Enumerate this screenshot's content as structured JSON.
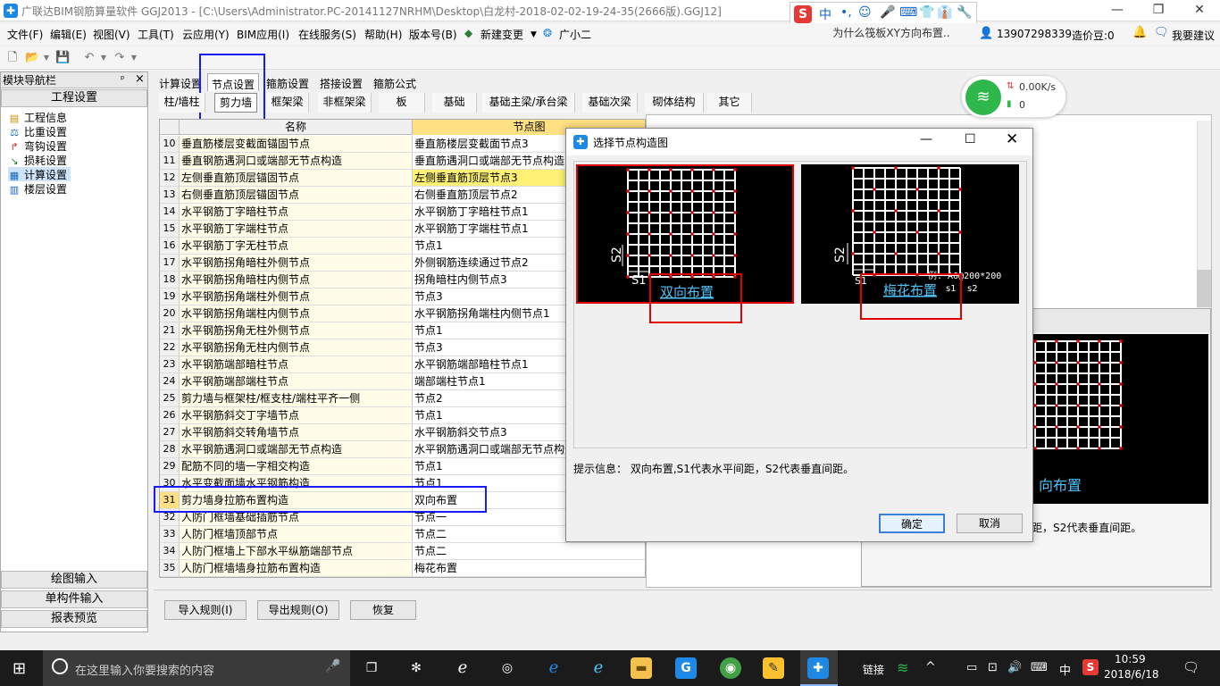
{
  "window": {
    "title": "广联达BIM钢筋算量软件 GGJ2013 - [C:\\Users\\Administrator.PC-20141127NRHM\\Desktop\\白龙村-2018-02-02-19-24-35(2666版).GGJ12]",
    "controls": [
      "—",
      "❐",
      "✕"
    ]
  },
  "ime": {
    "items": [
      "S",
      "中",
      "•,",
      "☺",
      "🎤",
      "⌨",
      "👕",
      "👔",
      "🔧"
    ]
  },
  "menu": {
    "items": [
      "文件(F)",
      "编辑(E)",
      "视图(V)",
      "工具(T)",
      "云应用(Y)",
      "BIM应用(I)",
      "在线服务(S)",
      "帮助(H)",
      "版本号(B)",
      "新建变更",
      "广小二"
    ],
    "promo": "为什么筏板XY方向布置..",
    "phone": "13907298339",
    "credit": "造价豆:0",
    "suggest": "我要建议"
  },
  "leftnav": {
    "title": "模块导航栏",
    "pin": "ᵖ",
    "close": "×",
    "section_top": "工程设置",
    "items": [
      "工程信息",
      "比重设置",
      "弯钩设置",
      "损耗设置",
      "计算设置",
      "楼层设置"
    ],
    "bottom_sections": [
      "绘图输入",
      "单构件输入",
      "报表预览"
    ]
  },
  "tabs": [
    "计算设置",
    "节点设置",
    "箍筋设置",
    "搭接设置",
    "箍筋公式"
  ],
  "active_tab": "节点设置",
  "subtabs": [
    "柱/墙柱",
    "剪力墙",
    "框架梁",
    "非框架梁",
    "板",
    "基础",
    "基础主梁/承台梁",
    "基础次梁",
    "砌体结构",
    "其它"
  ],
  "active_subtab": "剪力墙",
  "grid": {
    "headers": [
      "名称",
      "节点图"
    ],
    "rows": [
      {
        "num": "10",
        "name": "垂直筋楼层变截面锚固节点",
        "val": "垂直筋楼层变截面节点3"
      },
      {
        "num": "11",
        "name": "垂直钢筋遇洞口或端部无节点构造",
        "val": "垂直筋遇洞口或端部无节点构造1"
      },
      {
        "num": "12",
        "name": "左侧垂直筋顶层锚固节点",
        "val": "左侧垂直筋顶层节点3"
      },
      {
        "num": "13",
        "name": "右侧垂直筋顶层锚固节点",
        "val": "右侧垂直筋顶层节点2"
      },
      {
        "num": "14",
        "name": "水平钢筋丁字暗柱节点",
        "val": "水平钢筋丁字暗柱节点1"
      },
      {
        "num": "15",
        "name": "水平钢筋丁字端柱节点",
        "val": "水平钢筋丁字端柱节点1"
      },
      {
        "num": "16",
        "name": "水平钢筋丁字无柱节点",
        "val": "节点1"
      },
      {
        "num": "17",
        "name": "水平钢筋拐角暗柱外侧节点",
        "val": "外侧钢筋连续通过节点2"
      },
      {
        "num": "18",
        "name": "水平钢筋拐角暗柱内侧节点",
        "val": "拐角暗柱内侧节点3"
      },
      {
        "num": "19",
        "name": "水平钢筋拐角端柱外侧节点",
        "val": "节点3"
      },
      {
        "num": "20",
        "name": "水平钢筋拐角端柱内侧节点",
        "val": "水平钢筋拐角端柱内侧节点1"
      },
      {
        "num": "21",
        "name": "水平钢筋拐角无柱外侧节点",
        "val": "节点1"
      },
      {
        "num": "22",
        "name": "水平钢筋拐角无柱内侧节点",
        "val": "节点3"
      },
      {
        "num": "23",
        "name": "水平钢筋端部暗柱节点",
        "val": "水平钢筋端部暗柱节点1"
      },
      {
        "num": "24",
        "name": "水平钢筋端部端柱节点",
        "val": "端部端柱节点1"
      },
      {
        "num": "25",
        "name": "剪力墙与框架柱/框支柱/端柱平齐一侧",
        "val": "节点2"
      },
      {
        "num": "26",
        "name": "水平钢筋斜交丁字墙节点",
        "val": "节点1"
      },
      {
        "num": "27",
        "name": "水平钢筋斜交转角墙节点",
        "val": "水平钢筋斜交节点3"
      },
      {
        "num": "28",
        "name": "水平钢筋遇洞口或端部无节点构造",
        "val": "水平钢筋遇洞口或端部无节点构造"
      },
      {
        "num": "29",
        "name": "配筋不同的墙一字相交构造",
        "val": "节点1"
      },
      {
        "num": "30",
        "name": "水平变截面墙水平钢筋构造",
        "val": "节点1"
      },
      {
        "num": "31",
        "name": "剪力墙身拉筋布置构造",
        "val": "双向布置"
      },
      {
        "num": "32",
        "name": "人防门框墙基础插筋节点",
        "val": "节点一"
      },
      {
        "num": "33",
        "name": "人防门框墙顶部节点",
        "val": "节点二"
      },
      {
        "num": "34",
        "name": "人防门框墙上下部水平纵筋端部节点",
        "val": "节点二"
      },
      {
        "num": "35",
        "name": "人防门框墙墙身拉筋布置构造",
        "val": "梅花布置"
      }
    ]
  },
  "bottom_buttons": [
    "导入规则(I)",
    "导出规则(O)",
    "恢复"
  ],
  "preview": {
    "caption": "向布置",
    "info": "距，S2代表垂直间距。"
  },
  "network": {
    "speed": "0.00K/s",
    "count": "0"
  },
  "dialog": {
    "title": "选择节点构造图",
    "option1": "双向布置",
    "option2": "梅花布置",
    "option2_note": "例: A6@200*200",
    "s1": "S1",
    "s2": "S2",
    "small_s1": "s1",
    "small_s2": "s2",
    "info": "提示信息： 双向布置,S1代表水平间距，S2代表垂直间距。",
    "ok": "确定",
    "cancel": "取消"
  },
  "taskbar": {
    "search_placeholder": "在这里输入你要搜索的内容",
    "link": "链接",
    "lang": "中",
    "time": "10:59",
    "date": "2018/6/18"
  }
}
